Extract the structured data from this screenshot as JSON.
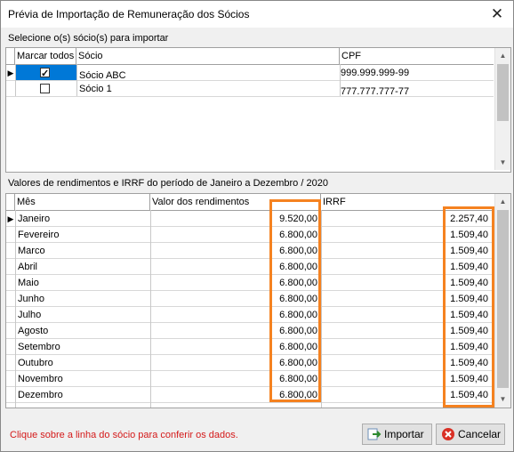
{
  "window": {
    "title": "Prévia de Importação de Remuneração dos Sócios",
    "close_glyph": "✕"
  },
  "socios_section": {
    "label": "Selecione o(s) sócio(s) para importar",
    "columns": {
      "select_all": "Marcar todos",
      "socio": "Sócio",
      "cpf": "CPF"
    },
    "rows": [
      {
        "checked": true,
        "name": "Sócio ABC",
        "cpf": "999.999.999-99",
        "current": true
      },
      {
        "checked": false,
        "name": "Sócio 1",
        "cpf": "777.777.777-77",
        "current": false
      }
    ]
  },
  "valores_section": {
    "label": "Valores de rendimentos e IRRF do período de Janeiro a Dezembro / 2020",
    "columns": {
      "mes": "Mês",
      "valor": "Valor dos rendimentos",
      "irrf": "IRRF"
    },
    "rows": [
      {
        "mes": "Janeiro",
        "valor": "9.520,00",
        "irrf": "2.257,40",
        "current": true
      },
      {
        "mes": "Fevereiro",
        "valor": "6.800,00",
        "irrf": "1.509,40"
      },
      {
        "mes": "Marco",
        "valor": "6.800,00",
        "irrf": "1.509,40"
      },
      {
        "mes": "Abril",
        "valor": "6.800,00",
        "irrf": "1.509,40"
      },
      {
        "mes": "Maio",
        "valor": "6.800,00",
        "irrf": "1.509,40"
      },
      {
        "mes": "Junho",
        "valor": "6.800,00",
        "irrf": "1.509,40"
      },
      {
        "mes": "Julho",
        "valor": "6.800,00",
        "irrf": "1.509,40"
      },
      {
        "mes": "Agosto",
        "valor": "6.800,00",
        "irrf": "1.509,40"
      },
      {
        "mes": "Setembro",
        "valor": "6.800,00",
        "irrf": "1.509,40"
      },
      {
        "mes": "Outubro",
        "valor": "6.800,00",
        "irrf": "1.509,40"
      },
      {
        "mes": "Novembro",
        "valor": "6.800,00",
        "irrf": "1.509,40"
      },
      {
        "mes": "Dezembro",
        "valor": "6.800,00",
        "irrf": "1.509,40"
      }
    ]
  },
  "footer": {
    "hint": "Clique sobre a linha do sócio para conferir os dados.",
    "import_label": "Importar",
    "cancel_label": "Cancelar"
  },
  "colors": {
    "highlight": "#f58220",
    "selected_cell": "#0078d7",
    "hint_text": "#d41a1a"
  }
}
